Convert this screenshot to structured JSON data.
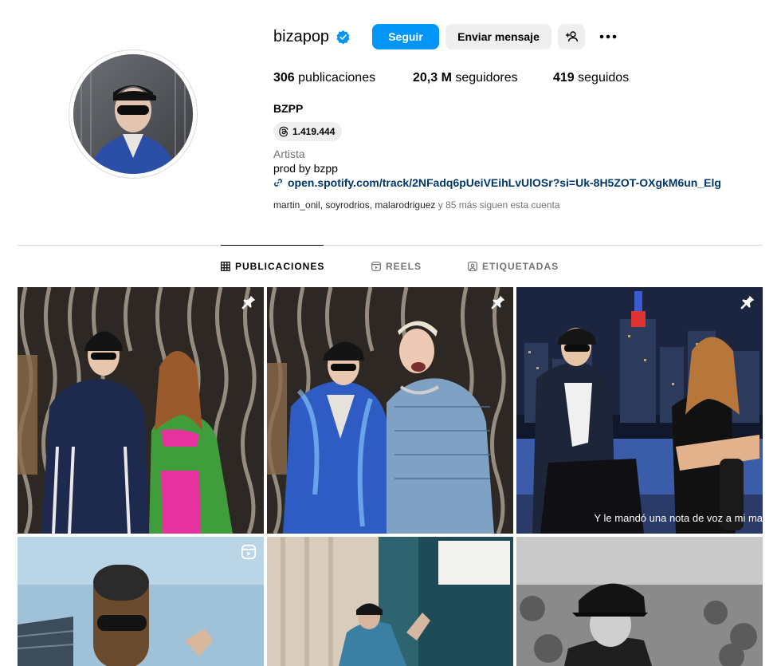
{
  "profile": {
    "username": "bizapop",
    "verified": true,
    "full_name": "BZPP",
    "threads_count": "1.419.444",
    "category": "Artista",
    "bio": "prod by bzpp",
    "link": "open.spotify.com/track/2NFadq6pUeiVEihLvUlOSr?si=Uk-8H5ZOT-OXgkM6un_Elg",
    "followed_by_names": "martin_onil, soyrodrios, malarodriguez",
    "followed_by_rest": " y 85 más siguen esta cuenta"
  },
  "actions": {
    "follow": "Seguir",
    "message": "Enviar mensaje"
  },
  "stats": {
    "posts_value": "306",
    "posts_label": " publicaciones",
    "followers_value": "20,3 M",
    "followers_label": " seguidores",
    "following_value": "419",
    "following_label": " seguidos"
  },
  "tabs": {
    "posts": "PUBLICACIONES",
    "reels": "REELS",
    "tagged": "ETIQUETADAS"
  },
  "posts": [
    {
      "pinned": true
    },
    {
      "pinned": true
    },
    {
      "pinned": true,
      "caption": "Y le mandó una nota de voz a mi ma"
    },
    {
      "reel": true
    },
    {},
    {}
  ],
  "colors": {
    "accent": "#0095f6",
    "link": "#00376b",
    "secondary_text": "#737373",
    "button_bg": "#efefef"
  }
}
